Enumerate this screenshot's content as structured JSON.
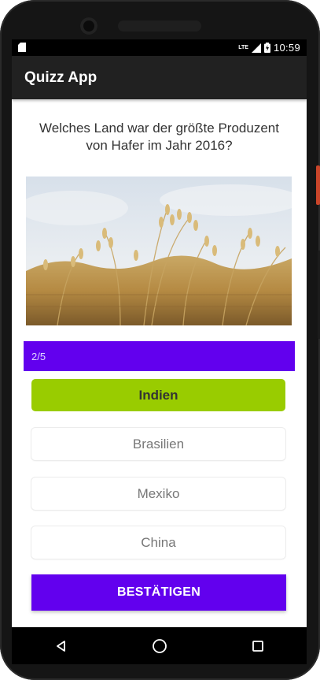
{
  "status": {
    "time": "10:59",
    "network": "LTE"
  },
  "app": {
    "title": "Quizz App"
  },
  "quiz": {
    "question": "Welches Land war der größte Produzent von Hafer im Jahr 2016?",
    "image_icon": "oat-field-image",
    "progress_text": "2/5",
    "progress_value": 0.4,
    "options": [
      {
        "label": "Indien",
        "selected": true
      },
      {
        "label": "Brasilien",
        "selected": false
      },
      {
        "label": "Mexiko",
        "selected": false
      },
      {
        "label": "China",
        "selected": false
      }
    ],
    "confirm_label": "BESTÄTIGEN"
  },
  "colors": {
    "accent": "#6200ee",
    "selected": "#99cc00",
    "appbar": "#212121"
  },
  "nav": {
    "back_icon": "back-triangle-icon",
    "home_icon": "home-circle-icon",
    "recents_icon": "recents-square-icon"
  }
}
